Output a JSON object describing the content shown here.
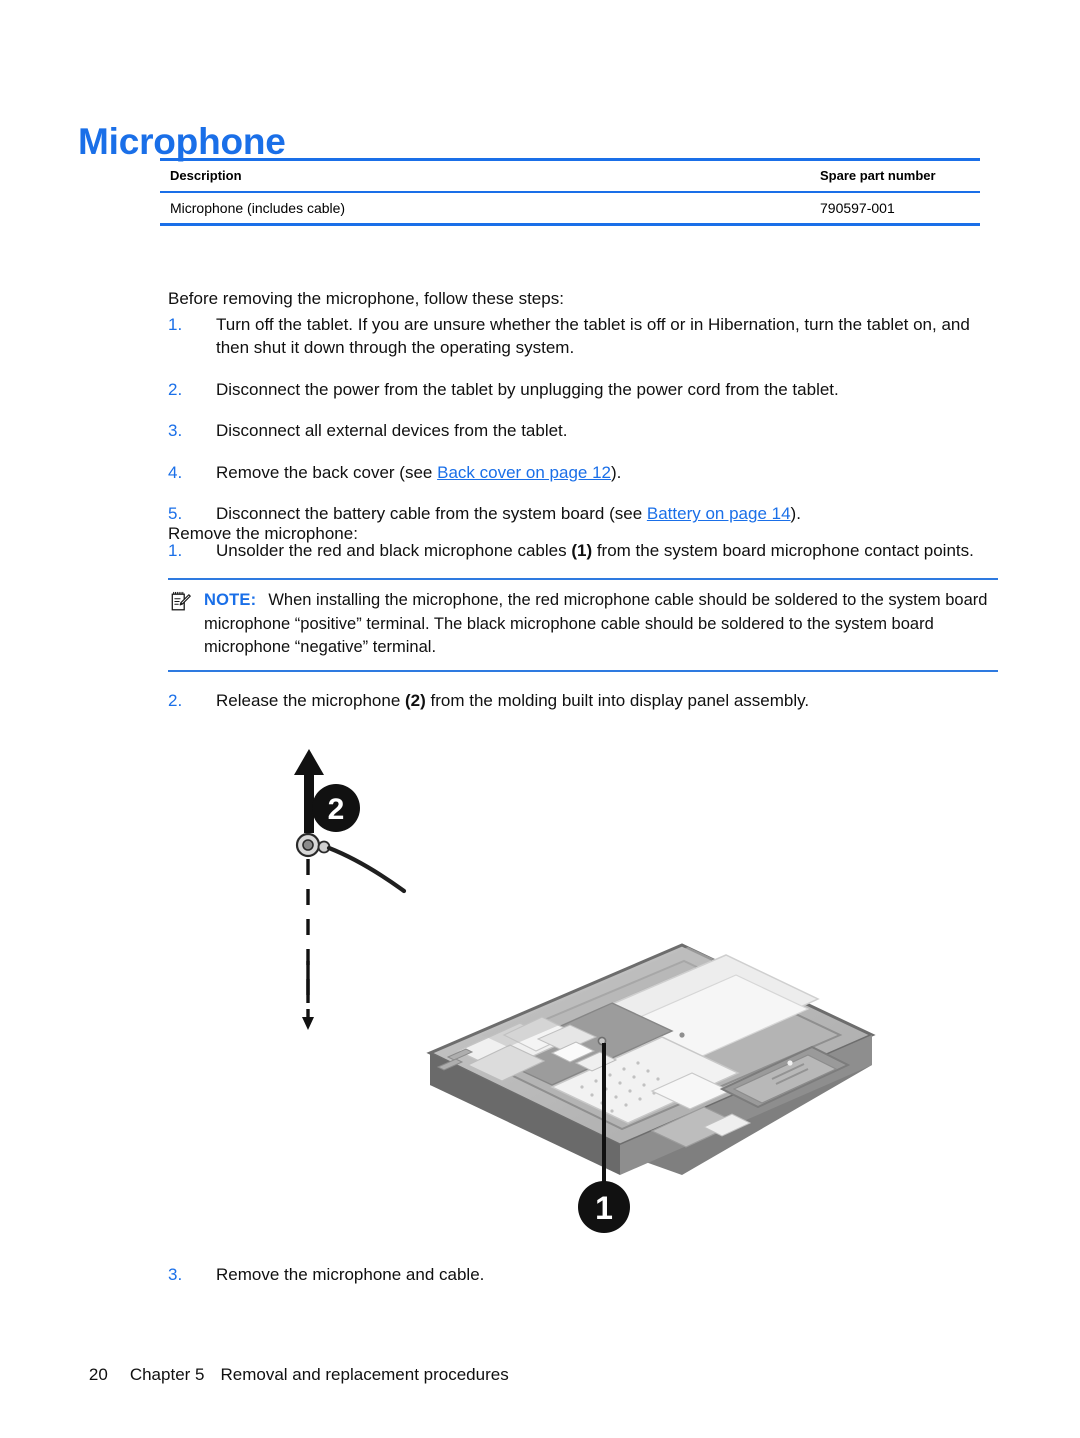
{
  "document": {
    "heading": "Microphone"
  },
  "parts_table": {
    "headers": [
      "Description",
      "Spare part number"
    ],
    "rows": [
      {
        "description": "Microphone (includes cable)",
        "spare_part_number": "790597-001"
      }
    ]
  },
  "intro": {
    "lead": "Before removing the microphone, follow these steps:"
  },
  "before_steps": [
    {
      "num": "1.",
      "text": "Turn off the tablet. If you are unsure whether the tablet is off or in Hibernation, turn the tablet on, and then shut it down through the operating system."
    },
    {
      "num": "2.",
      "text": "Disconnect the power from the tablet by unplugging the power cord from the tablet."
    },
    {
      "num": "3.",
      "text": "Disconnect all external devices from the tablet."
    },
    {
      "num": "4.",
      "text_before": "Remove the back cover (see ",
      "link": "Back cover on page 12",
      "text_after": ")."
    },
    {
      "num": "5.",
      "text_before": "Disconnect the battery cable from the system board (see ",
      "link": "Battery on page 14",
      "text_after": ")."
    }
  ],
  "remove_lead": "Remove the microphone:",
  "remove_steps": {
    "step1": {
      "num": "1.",
      "text_before": "Unsolder the red and black microphone cables ",
      "callout": "(1)",
      "text_after": " from the system board microphone contact points."
    },
    "step2": {
      "num": "2.",
      "text_before": "Release the microphone ",
      "callout": "(2)",
      "text_after": " from the molding built into display panel assembly."
    },
    "step3": {
      "num": "3.",
      "text": "Remove the microphone and cable."
    }
  },
  "note": {
    "label": "NOTE:",
    "icon": "note-pencil-icon",
    "text": "When installing the microphone, the red microphone cable should be soldered to the system board microphone “positive” terminal. The black microphone cable should be soldered to the system board microphone “negative” terminal."
  },
  "illustration": {
    "alt": "Exploded view of tablet display panel assembly with microphone removal callouts",
    "callouts": [
      {
        "id": "1",
        "label": "1",
        "meaning": "microphone cable solder contact points on system board"
      },
      {
        "id": "2",
        "label": "2",
        "meaning": "microphone released from molding, lifted out"
      }
    ]
  },
  "footer": {
    "page_number": "20",
    "chapter": "Chapter 5",
    "chapter_title": "Removal and replacement procedures"
  },
  "colors": {
    "accent_blue": "#1a6fe8",
    "link_blue": "#1a6fe8",
    "rule_blue": "#2e7ae0",
    "text": "#101010"
  }
}
